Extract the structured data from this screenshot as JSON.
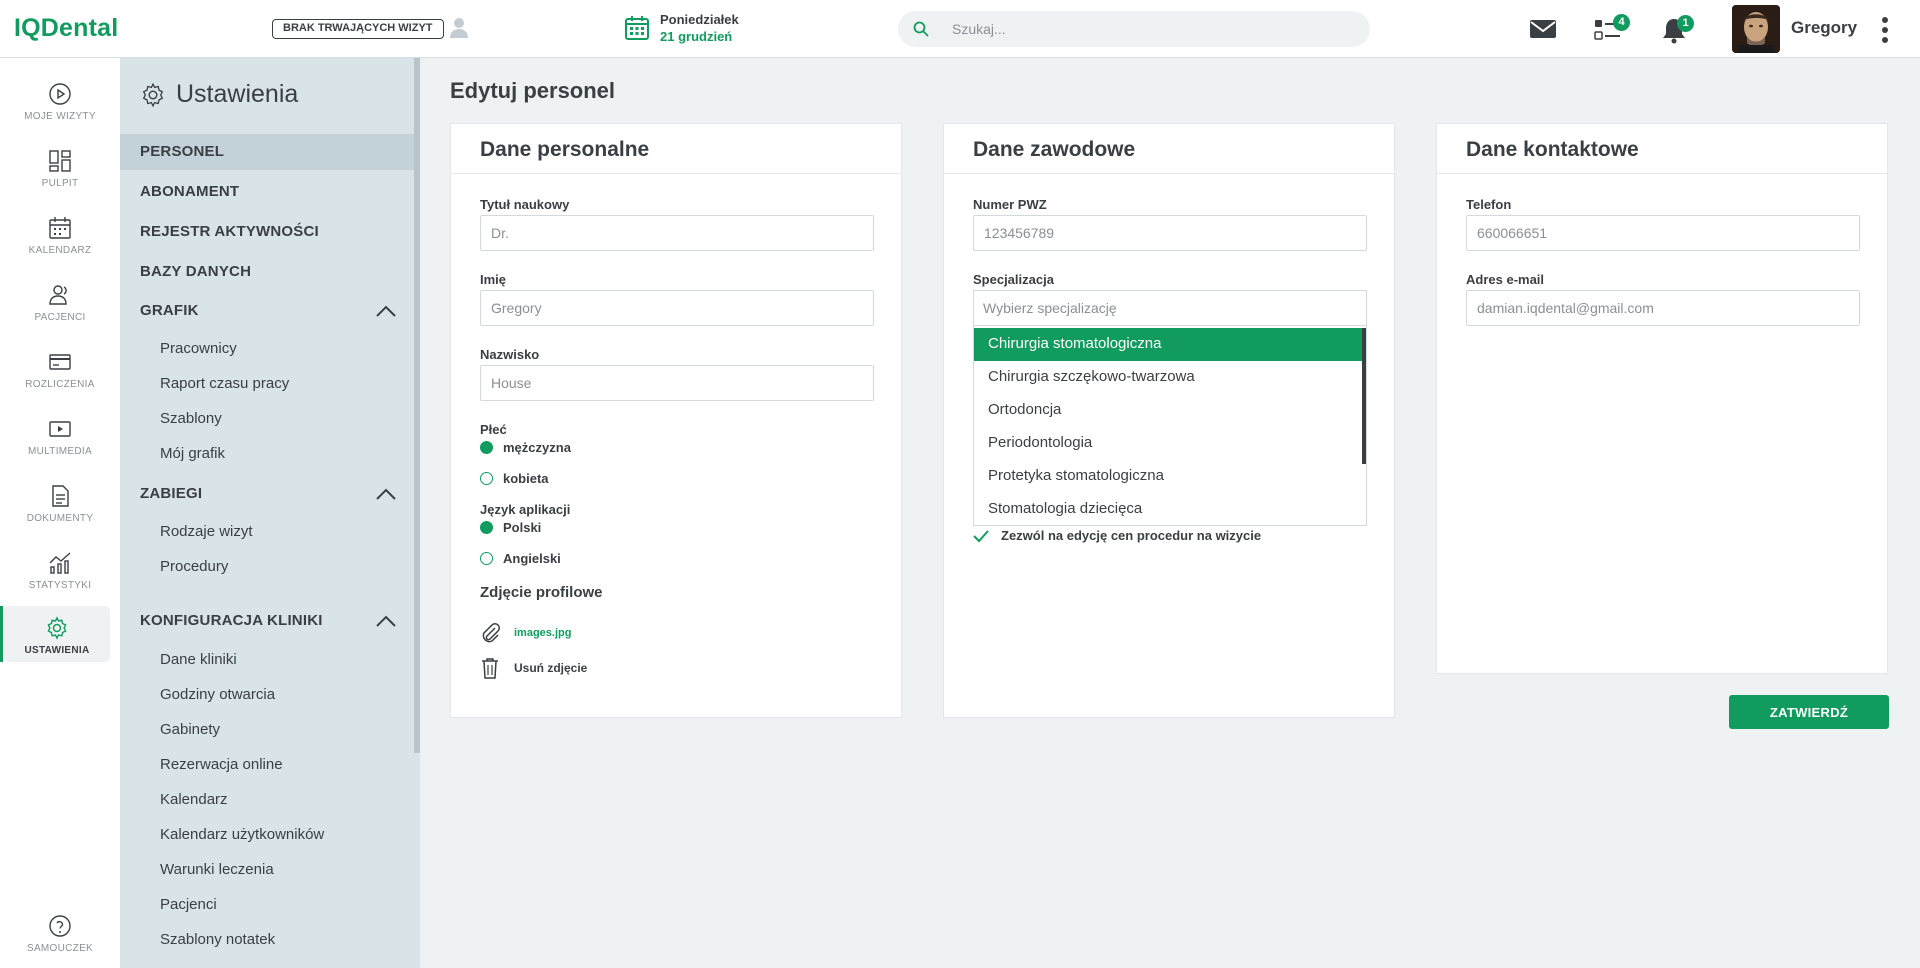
{
  "app": {
    "logo": "IQDental"
  },
  "header": {
    "visit_status": "BRAK TRWAJĄCYCH WIZYT",
    "day": "Poniedziałek",
    "date": "21 grudzień",
    "search_placeholder": "Szukaj...",
    "tasks_count": "4",
    "notifications_count": "1",
    "user_name": "Gregory"
  },
  "rail": {
    "items": [
      {
        "label": "MOJE WIZYTY",
        "icon": "play-circle-icon"
      },
      {
        "label": "PULPIT",
        "icon": "dashboard-icon"
      },
      {
        "label": "KALENDARZ",
        "icon": "calendar-icon"
      },
      {
        "label": "PACJENCI",
        "icon": "patients-icon"
      },
      {
        "label": "ROZLICZENIA",
        "icon": "credit-card-icon"
      },
      {
        "label": "MULTIMEDIA",
        "icon": "multimedia-icon"
      },
      {
        "label": "DOKUMENTY",
        "icon": "document-icon"
      },
      {
        "label": "STATYSTYKI",
        "icon": "stats-icon"
      },
      {
        "label": "USTAWIENIA",
        "icon": "gear-icon"
      }
    ],
    "help_label": "SAMOUCZEK"
  },
  "settings": {
    "title": "Ustawienia",
    "items": [
      "PERSONEL",
      "ABONAMENT",
      "REJESTR AKTYWNOŚCI",
      "BAZY DANYCH",
      "GRAFIK",
      "ZABIEGI",
      "KONFIGURACJA KLINIKI"
    ],
    "grafik_sub": [
      "Pracownicy",
      "Raport czasu pracy",
      "Szablony",
      "Mój grafik"
    ],
    "zabiegi_sub": [
      "Rodzaje wizyt",
      "Procedury"
    ],
    "klinika_sub": [
      "Dane kliniki",
      "Godziny otwarcia",
      "Gabinety",
      "Rezerwacja online",
      "Kalendarz",
      "Kalendarz użytkowników",
      "Warunki leczenia",
      "Pacjenci",
      "Szablony notatek"
    ]
  },
  "main": {
    "title": "Edytuj personel",
    "personal": {
      "title": "Dane personalne",
      "degree_label": "Tytuł naukowy",
      "degree_value": "Dr.",
      "first_label": "Imię",
      "first_value": "Gregory",
      "last_label": "Nazwisko",
      "last_value": "House",
      "gender_label": "Płeć",
      "gender_options": [
        "mężczyzna",
        "kobieta"
      ],
      "lang_label": "Język aplikacji",
      "lang_options": [
        "Polski",
        "Angielski"
      ],
      "photo_label": "Zdjęcie profilowe",
      "photo_file": "images.jpg",
      "remove_photo": "Usuń zdjęcie"
    },
    "professional": {
      "title": "Dane zawodowe",
      "pwz_label": "Numer PWZ",
      "pwz_value": "123456789",
      "spec_label": "Specjalizacja",
      "spec_placeholder": "Wybierz specjalizację",
      "spec_options": [
        "Chirurgia stomatologiczna",
        "Chirurgia szczękowo-twarzowa",
        "Ortodoncja",
        "Periodontologia",
        "Protetyka stomatologiczna",
        "Stomatologia dziecięca"
      ],
      "allow_edit_label": "Zezwól na edycję cen procedur na wizycie"
    },
    "contact": {
      "title": "Dane kontaktowe",
      "phone_label": "Telefon",
      "phone_value": "660066651",
      "email_label": "Adres e-mail",
      "email_value": "damian.iqdental@gmail.com"
    },
    "submit_label": "ZATWIERDŹ"
  },
  "colors": {
    "accent": "#129b5f",
    "sidebar": "#d9e4e9",
    "background": "#eef2f3"
  }
}
